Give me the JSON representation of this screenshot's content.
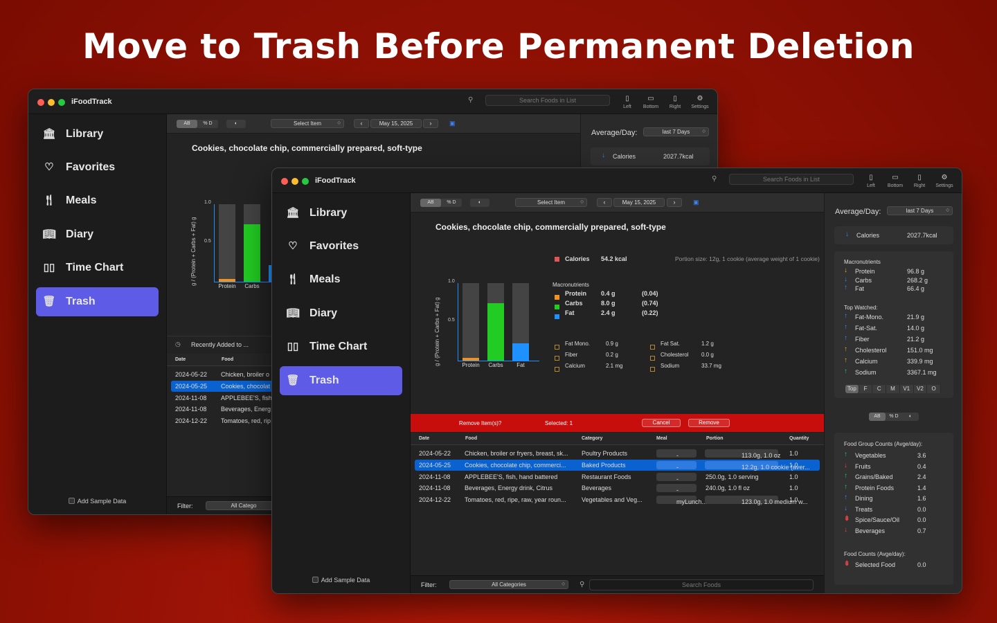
{
  "headline": "Move to Trash Before Permanent Deletion",
  "app_title": "iFoodTrack",
  "search_placeholder": "Search Foods in List",
  "toolbar_buttons": [
    "Left",
    "Bottom",
    "Right",
    "Settings"
  ],
  "sidebar": {
    "items": [
      {
        "label": "Library",
        "icon": "library-icon"
      },
      {
        "label": "Favorites",
        "icon": "heart-icon"
      },
      {
        "label": "Meals",
        "icon": "fork-knife-icon"
      },
      {
        "label": "Diary",
        "icon": "book-icon"
      },
      {
        "label": "Time Chart",
        "icon": "bar-chart-icon"
      },
      {
        "label": "Trash",
        "icon": "trash-icon"
      }
    ],
    "sample_data": "Add Sample Data"
  },
  "controls": {
    "seg1": [
      "AB",
      "% D"
    ],
    "select_item": "Select Item",
    "date": "May 15, 2025"
  },
  "food_title": "Cookies, chocolate chip, commercially prepared, soft-type",
  "nutrition": {
    "calories_label": "Calories",
    "calories_value": "54.2 kcal",
    "portion": "Portion size: 12g, 1 cookie (average weight of 1 cookie)",
    "macro_header": "Macronutrients",
    "macros": [
      {
        "name": "Protein",
        "value": "0.4 g",
        "ratio": "(0.04)",
        "color": "#f5921e"
      },
      {
        "name": "Carbs",
        "value": "8.0 g",
        "ratio": "(0.74)",
        "color": "#22cc22"
      },
      {
        "name": "Fat",
        "value": "2.4 g",
        "ratio": "(0.22)",
        "color": "#1e90ff"
      }
    ],
    "micro_left": [
      {
        "name": "Fat Mono.",
        "value": "0.9 g"
      },
      {
        "name": "Fiber",
        "value": "0.2 g"
      },
      {
        "name": "Calcium",
        "value": "2.1 mg"
      }
    ],
    "micro_right": [
      {
        "name": "Fat Sat.",
        "value": "1.2 g"
      },
      {
        "name": "Cholesterol",
        "value": "0.0 g"
      },
      {
        "name": "Sodium",
        "value": "33.7 mg"
      }
    ]
  },
  "chart_data": {
    "type": "bar",
    "ylabel": "g / (Protein + Carbs + Fat) g",
    "ylim": [
      0,
      1
    ],
    "yticks": [
      "1.0",
      "0.5"
    ],
    "categories": [
      "Protein",
      "Carbs",
      "Fat"
    ],
    "values": [
      0.04,
      0.74,
      0.22
    ],
    "colors": [
      "#f5921e",
      "#22cc22",
      "#1e90ff"
    ]
  },
  "back_chart_categories": [
    "Protein",
    "Carbs"
  ],
  "delete_bar": {
    "prompt": "Remove Item(s)?",
    "selected": "Selected: 1",
    "cancel": "Cancel",
    "remove": "Remove"
  },
  "recent_header": "Recently Added to ...",
  "table": {
    "headers": [
      "Date",
      "Food",
      "Category",
      "Meal",
      "Portion",
      "Quantity"
    ],
    "rows": [
      {
        "date": "2024-05-22",
        "food": "Chicken, broiler or fryers, breast, sk...",
        "back_food": "Chicken, broiler o",
        "category": "Poultry Products",
        "meal": "-",
        "portion": "113.0g, 1.0 oz",
        "quantity": "1.0",
        "chip": true
      },
      {
        "date": "2024-05-25",
        "food": "Cookies, chocolate chip, commerci...",
        "back_food": "Cookies, chocolat",
        "category": "Baked Products",
        "meal": "-",
        "portion": "12.2g, 1.0 cookie (aver...",
        "quantity": "1.0",
        "chip": true,
        "selected": true
      },
      {
        "date": "2024-11-08",
        "food": "APPLEBEE'S, fish, hand battered",
        "back_food": "APPLEBEE'S, fish,",
        "category": "Restaurant Foods",
        "meal": "-",
        "portion": "250.0g, 1.0 serving",
        "quantity": "1.0",
        "chip": false
      },
      {
        "date": "2024-11-08",
        "food": "Beverages,  Energy drink, Citrus",
        "back_food": "Beverages,  Energ",
        "category": "Beverages",
        "meal": "-",
        "portion": "240.0g, 1.0 fl oz",
        "quantity": "1.0",
        "chip": false
      },
      {
        "date": "2024-12-22",
        "food": "Tomatoes, red, ripe, raw, year roun...",
        "back_food": "Tomatoes, red, rip",
        "category": "Vegetables and Veg...",
        "meal": "myLunch...",
        "portion": "123.0g, 1.0 medium w...",
        "quantity": "1.0",
        "chip": true
      }
    ]
  },
  "filter": {
    "label": "Filter:",
    "value": "All Categories",
    "back_value": "All Catego",
    "search_placeholder": "Search Foods"
  },
  "right_panel": {
    "avg_label": "Average/Day:",
    "range": "last 7 Days",
    "calories_label": "Calories",
    "calories_value": "2027.7kcal",
    "macro_header": "Macronutrients",
    "macros": [
      {
        "name": "Protein",
        "value": "96.8 g",
        "arrow": "↓",
        "color": "#e6a817"
      },
      {
        "name": "Carbs",
        "value": "268.2 g",
        "arrow": "↓",
        "color": "#3b82f6"
      },
      {
        "name": "Fat",
        "value": "66.4 g",
        "arrow": "↑",
        "color": "#3b82f6"
      }
    ],
    "watched_header": "Top Watched:",
    "watched": [
      {
        "name": "Fat-Mono.",
        "value": "21.9 g",
        "arrow": "↑",
        "color": "#3b82f6"
      },
      {
        "name": "Fat-Sat.",
        "value": "14.0 g",
        "arrow": "↑",
        "color": "#3b82f6"
      },
      {
        "name": "Fiber",
        "value": "21.2 g",
        "arrow": "↑",
        "color": "#3b82f6"
      },
      {
        "name": "Cholesterol",
        "value": "151.0 mg",
        "arrow": "↑",
        "color": "#e6a817"
      },
      {
        "name": "Calcium",
        "value": "339.9 mg",
        "arrow": "↑",
        "color": "#e6a817"
      },
      {
        "name": "Sodium",
        "value": "3367.1 mg",
        "arrow": "↑",
        "color": "#22c55e"
      }
    ],
    "tabs": [
      "Top",
      "F",
      "C",
      "M",
      "V1",
      "V2",
      "O"
    ],
    "seg2": [
      "AB",
      "% D"
    ],
    "group_header": "Food Group Counts (Avge/day):",
    "groups": [
      {
        "name": "Vegetables",
        "value": "3.6",
        "arrow": "↑",
        "color": "#22c55e"
      },
      {
        "name": "Fruits",
        "value": "0.4",
        "arrow": "↓",
        "color": "#ef4444"
      },
      {
        "name": "Grains/Baked",
        "value": "2.4",
        "arrow": "↑",
        "color": "#22c55e"
      },
      {
        "name": "Protein Foods",
        "value": "1.4",
        "arrow": "↑",
        "color": "#22c55e"
      },
      {
        "name": "Dining",
        "value": "1.6",
        "arrow": "↑",
        "color": "#3b82f6"
      },
      {
        "name": "Treats",
        "value": "0.0",
        "arrow": "↓",
        "color": "#3b82f6"
      },
      {
        "name": "Spice/Sauce/Oil",
        "value": "0.0",
        "arrow": "⇟",
        "color": "#ef4444"
      },
      {
        "name": "Beverages",
        "value": "0.7",
        "arrow": "↓",
        "color": "#ef4444"
      }
    ],
    "counts_header": "Food Counts (Avge/day):",
    "counts": [
      {
        "name": "Selected Food",
        "value": "0.0",
        "arrow": "⇟",
        "color": "#ef4444"
      }
    ]
  }
}
